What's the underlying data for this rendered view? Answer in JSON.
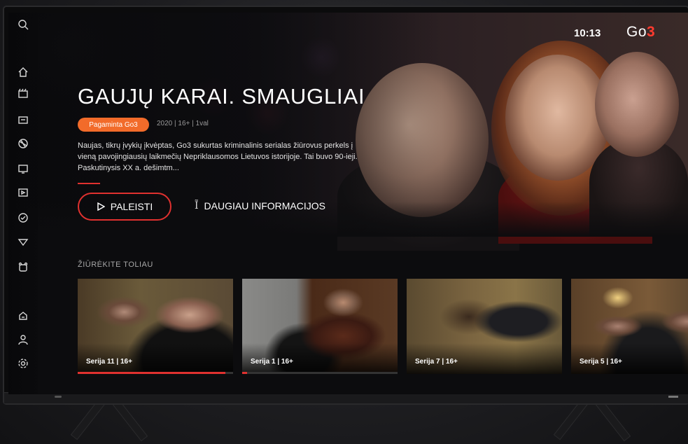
{
  "header": {
    "clock": "10:13",
    "logo_text": "Go",
    "logo_accent": "3"
  },
  "sidebar": {
    "items": [
      {
        "icon": "search-icon"
      },
      {
        "icon": "home-icon"
      },
      {
        "icon": "movies-icon"
      },
      {
        "icon": "tv-guide-icon"
      },
      {
        "icon": "sports-icon"
      },
      {
        "icon": "live-tv-icon"
      },
      {
        "icon": "series-icon"
      },
      {
        "icon": "recordings-icon"
      },
      {
        "icon": "favorites-icon"
      },
      {
        "icon": "kids-icon"
      },
      {
        "icon": "store-icon"
      },
      {
        "icon": "profile-icon"
      },
      {
        "icon": "settings-icon"
      }
    ]
  },
  "hero": {
    "title": "GAUJŲ KARAI. SMAUGLIAI",
    "badge": "Pagaminta Go3",
    "meta": "2020 | 16+ | 1val",
    "description": "Naujas, tikrų įvykių įkvėptas, Go3 sukurtas kriminalinis serialas žiūrovus perkels į vieną pavojingiausių laikmečių Nepriklausomos Lietuvos istorijoje. Tai buvo 90-ieji. Paskutinysis XX a. dešimtm...",
    "play_label": "PALEISTI",
    "info_label": "DAUGIAU INFORMACIJOS"
  },
  "continue_watching": {
    "title": "ŽIŪRĖKITE TOLIAU",
    "items": [
      {
        "label": "Serija 11 | 16+",
        "progress": 0.95
      },
      {
        "label": "Serija 1 | 16+",
        "progress": 0.03
      },
      {
        "label": "Serija 7 | 16+",
        "progress": 0.0
      },
      {
        "label": "Serija 5 | 16+",
        "progress": 0.0
      }
    ]
  },
  "colors": {
    "accent": "#e0312f",
    "badge": "#f26b2a"
  }
}
